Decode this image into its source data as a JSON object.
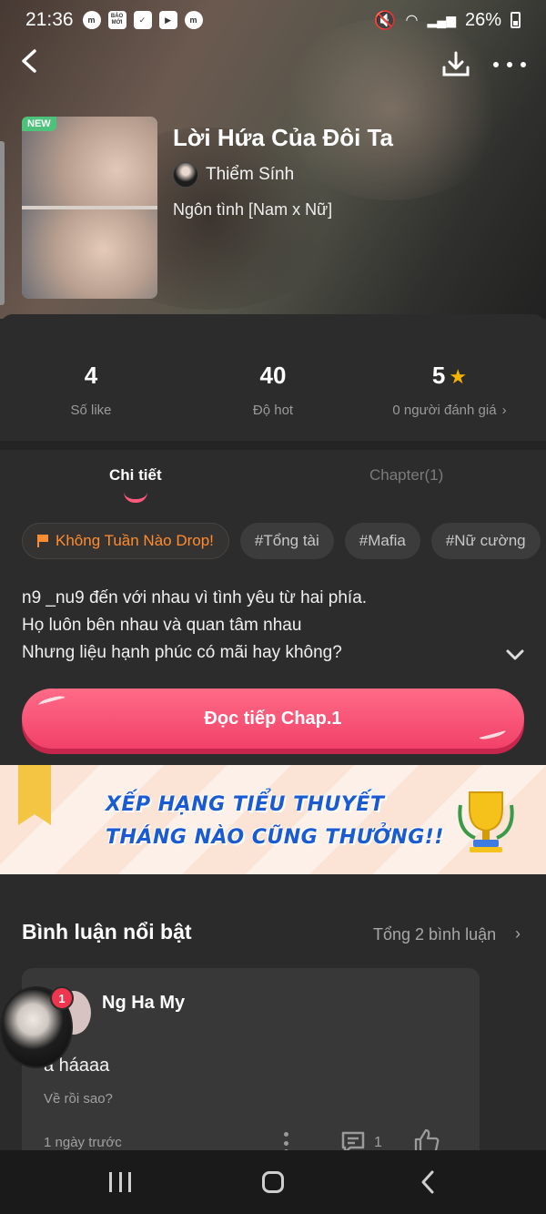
{
  "status_bar": {
    "time": "21:36",
    "battery": "26%",
    "app_icons": [
      "messenger-icon",
      "bao-moi-icon",
      "check-icon",
      "video-icon",
      "messenger-icon"
    ],
    "bao_moi_label": "BÁO MỚI"
  },
  "story": {
    "badge": "NEW",
    "title": "Lời Hứa Của Đôi Ta",
    "author": "Thiểm Sính",
    "genre": "Ngôn tình [Nam x Nữ]"
  },
  "stats": {
    "likes": {
      "value": "4",
      "label": "Số like"
    },
    "hot": {
      "value": "40",
      "label": "Độ hot"
    },
    "rating": {
      "value": "5",
      "label": "0 người đánh giá"
    }
  },
  "tabs": [
    {
      "label": "Chi tiết",
      "active": true
    },
    {
      "label": "Chapter(1)",
      "active": false
    }
  ],
  "tags": [
    "Không Tuần Nào Drop!",
    "#Tổng tài",
    "#Mafia",
    "#Nữ cường"
  ],
  "description": [
    "n9 _nu9 đến với nhau vì tình yêu từ hai phía.",
    "Họ luôn bên nhau và quan tâm nhau",
    "Nhưng liệu hạnh phúc có mãi hay không?"
  ],
  "read_button": "Đọc tiếp Chap.1",
  "banner": {
    "line1": "XẾP HẠNG TIỂU THUYẾT",
    "line2": "THÁNG NÀO CŨNG THƯỞNG!!"
  },
  "comments": {
    "title": "Bình luận nổi bật",
    "total": "Tổng 2 bình luận",
    "items": [
      {
        "name": "Ng Ha My",
        "text": "a háaaa",
        "reply": "Về rồi sao?",
        "time": "1 ngày trước",
        "reply_count": "1"
      }
    ]
  },
  "floating_bubble": {
    "badge": "1"
  },
  "colors": {
    "accent": "#f2416a",
    "tag_highlight": "#ff8c2f",
    "star": "#f5b400",
    "banner_text": "#1b5bd1"
  }
}
